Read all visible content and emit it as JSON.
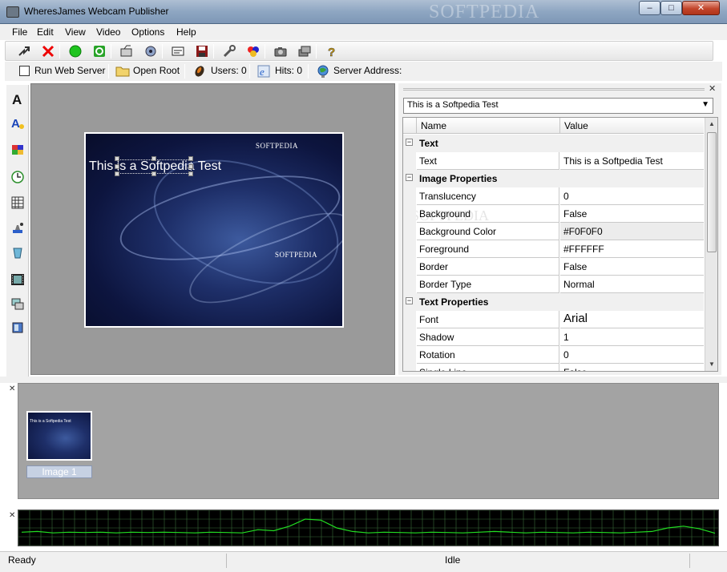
{
  "window": {
    "title": "WheresJames Webcam Publisher",
    "watermark": "SOFTPEDIA",
    "minimize_glyph": "–",
    "maximize_glyph": "□",
    "close_glyph": "✕"
  },
  "menu": [
    "File",
    "Edit",
    "View",
    "Video",
    "Options",
    "Help"
  ],
  "toolbar": {
    "icons": [
      "open-icon",
      "delete-icon",
      "start-icon",
      "refresh-icon",
      "capture-icon",
      "record-icon",
      "caption-icon",
      "save-icon",
      "tools-icon",
      "palette-icon",
      "camera-icon",
      "camera2-icon",
      "help-icon"
    ]
  },
  "server_bar": {
    "run_web_server": "Run Web Server",
    "open_root": "Open Root",
    "users": "Users: 0",
    "hits": "Hits: 0",
    "server_address": "Server Address:"
  },
  "left_tools": [
    "text-tool-icon",
    "text-effects-icon",
    "color-blocks-icon",
    "clock-icon",
    "grid-icon",
    "stamp-icon",
    "bucket-icon",
    "film-icon",
    "monitor-icon",
    "device-icon"
  ],
  "preview": {
    "overlay_text": "This is a Softpedia Test",
    "logo_top": "SOFTPEDIA",
    "logo_mid": "SOFTPEDIA"
  },
  "properties": {
    "selected_object": "This is a Softpedia Test",
    "col_name": "Name",
    "col_value": "Value",
    "rows": [
      {
        "type": "cat",
        "label": "Text"
      },
      {
        "type": "prop",
        "name": "Text",
        "value": "This is a Softpedia Test"
      },
      {
        "type": "cat",
        "label": "Image Properties"
      },
      {
        "type": "prop",
        "name": "Translucency",
        "value": "0"
      },
      {
        "type": "prop",
        "name": "Background",
        "value": "False"
      },
      {
        "type": "prop",
        "name": "Background Color",
        "value": "#F0F0F0"
      },
      {
        "type": "prop",
        "name": "Foreground",
        "value": "#FFFFFF"
      },
      {
        "type": "prop",
        "name": "Border",
        "value": "False"
      },
      {
        "type": "prop",
        "name": "Border Type",
        "value": "Normal"
      },
      {
        "type": "cat",
        "label": "Text Properties"
      },
      {
        "type": "prop",
        "name": "Font",
        "value": "Arial"
      },
      {
        "type": "prop",
        "name": "Shadow",
        "value": "1"
      },
      {
        "type": "prop",
        "name": "Rotation",
        "value": "0"
      },
      {
        "type": "prop",
        "name": "Single Line",
        "value": "False"
      }
    ]
  },
  "thumbnails": [
    {
      "label": "Image 1",
      "caption": "This is a Softpedia Test"
    }
  ],
  "activity_graph": {
    "line_color": "#22dd22",
    "grid_color": "#3a6a3a",
    "levels": [
      0.38,
      0.4,
      0.36,
      0.38,
      0.37,
      0.38,
      0.36,
      0.38,
      0.37,
      0.38,
      0.37,
      0.36,
      0.38,
      0.37,
      0.36,
      0.45,
      0.42,
      0.55,
      0.75,
      0.72,
      0.5,
      0.4,
      0.36,
      0.38,
      0.37,
      0.36,
      0.38,
      0.37,
      0.36,
      0.38,
      0.4,
      0.38,
      0.36,
      0.38,
      0.37,
      0.36,
      0.38,
      0.37,
      0.36,
      0.38,
      0.4,
      0.5,
      0.55,
      0.48,
      0.35
    ]
  },
  "status": {
    "left": "Ready",
    "middle": "Idle"
  }
}
